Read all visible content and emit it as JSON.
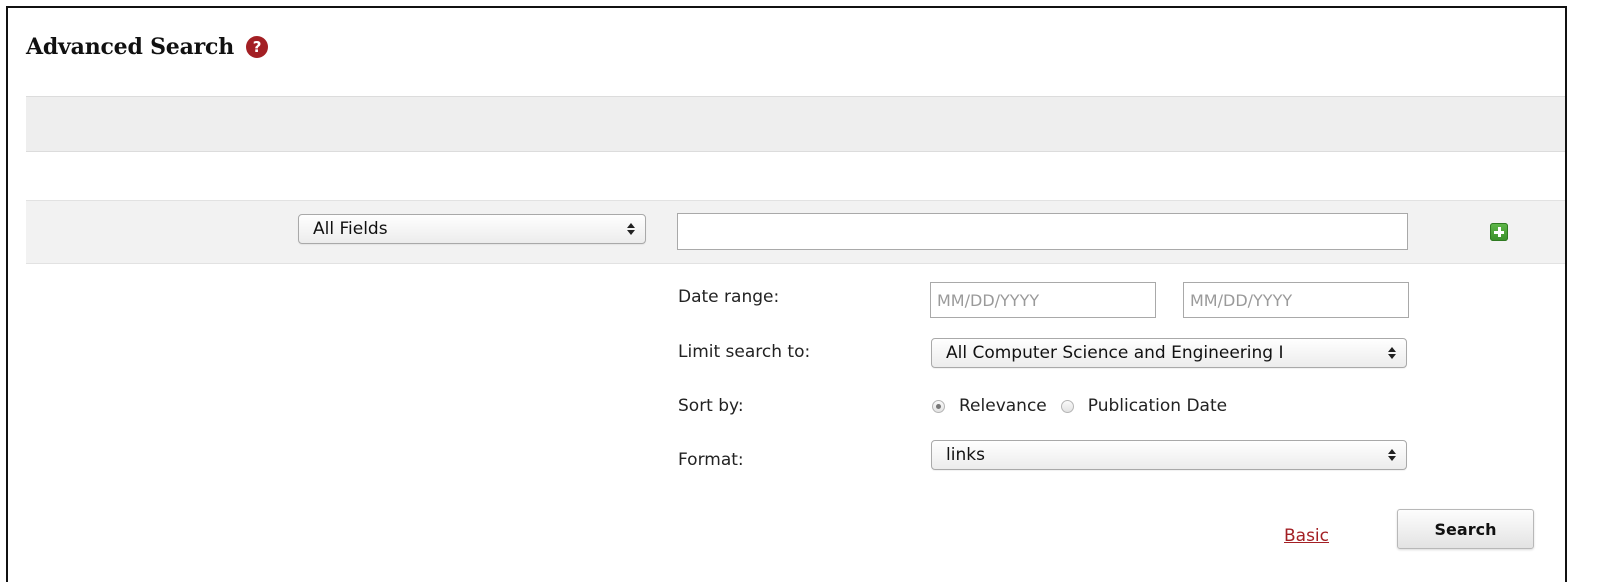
{
  "header": {
    "title": "Advanced Search",
    "help_icon": "?"
  },
  "query_row": {
    "field_select": {
      "selected": "All Fields"
    },
    "search_term": {
      "value": ""
    },
    "add_row_icon": "plus-icon"
  },
  "options": {
    "date_range": {
      "label": "Date range:",
      "from_placeholder": "MM/DD/YYYY",
      "to_placeholder": "MM/DD/YYYY"
    },
    "limit": {
      "label": "Limit search to:",
      "selected": "All Computer Science and Engineering I"
    },
    "sort": {
      "label": "Sort by:",
      "options": [
        "Relevance",
        "Publication Date"
      ],
      "selected": "Relevance"
    },
    "format": {
      "label": "Format:",
      "selected": "links"
    }
  },
  "actions": {
    "basic_link": "Basic",
    "search_button": "Search"
  },
  "colors": {
    "accent_red": "#a31f24",
    "add_green": "#3a8f2a",
    "bar_gray": "#eeeeee"
  }
}
